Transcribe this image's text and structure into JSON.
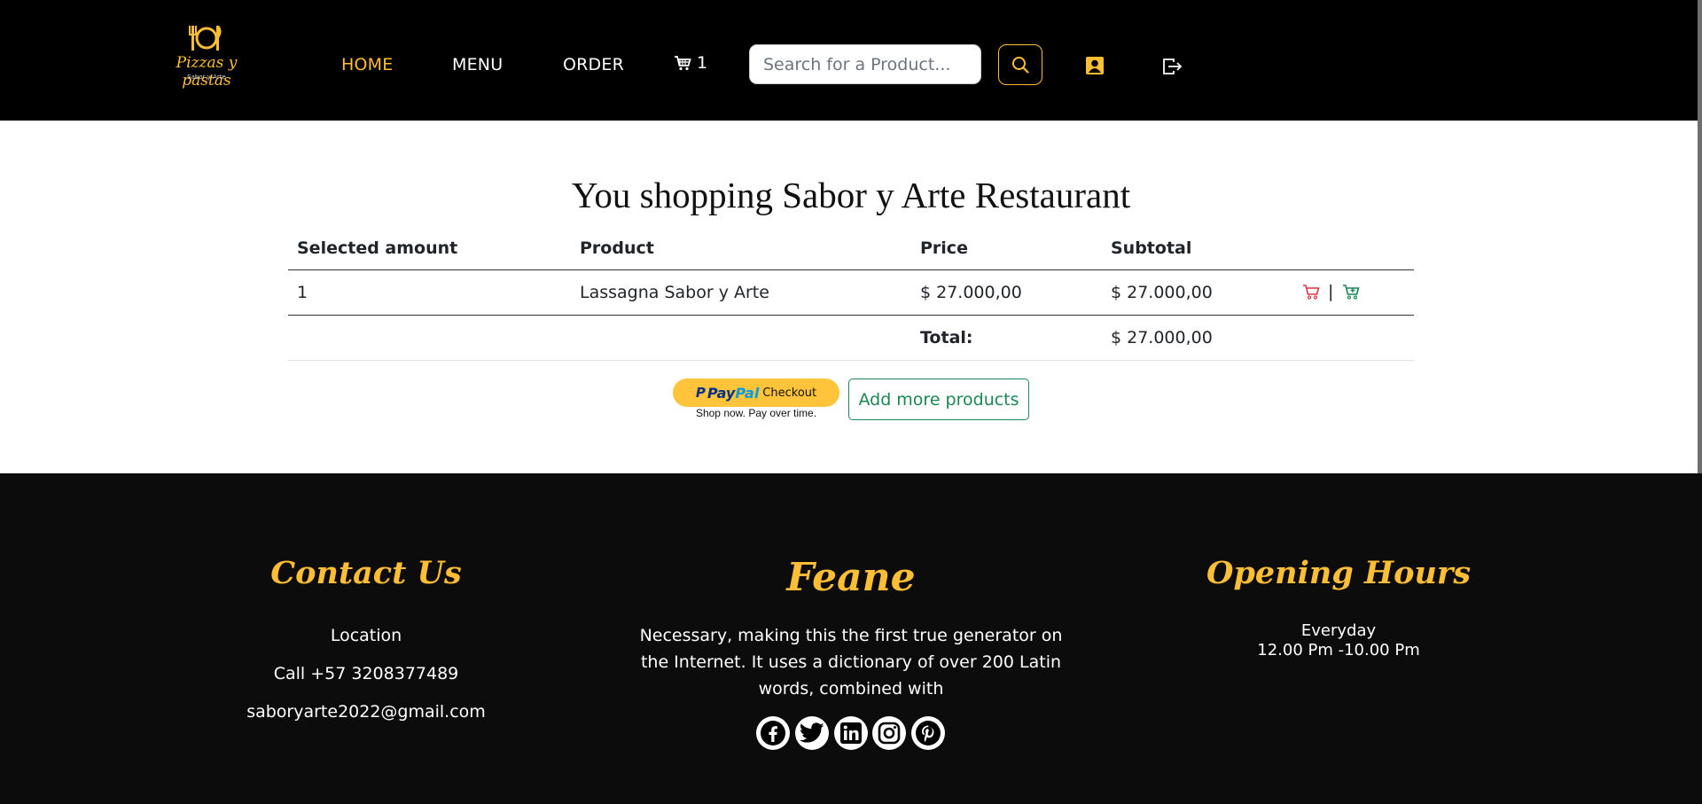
{
  "header": {
    "logo_text": "Pizzas y pastas",
    "logo_subtext": "Sabor y Arte",
    "nav": [
      {
        "label": "HOME",
        "active": true
      },
      {
        "label": "MENU",
        "active": false
      },
      {
        "label": "ORDER",
        "active": false
      }
    ],
    "cart_count": "1",
    "search_placeholder": "Search for a Product...",
    "icons": [
      "utensils-logo-icon",
      "cart-icon",
      "search-icon",
      "user-icon",
      "logout-icon"
    ]
  },
  "main": {
    "title": "You shopping Sabor y Arte Restaurant",
    "table": {
      "headers": [
        "Selected amount",
        "Product",
        "Price",
        "Subtotal"
      ],
      "rows": [
        {
          "amount": "1",
          "product": "Lassagna Sabor y Arte",
          "price": "$ 27.000,00",
          "subtotal": "$ 27.000,00"
        }
      ],
      "total_label": "Total:",
      "total_value": "$ 27.000,00",
      "action_separator": "|"
    },
    "paypal": {
      "brand_pay": "Pay",
      "brand_pal": "Pal",
      "label": "Checkout",
      "tagline": "Shop now. Pay over time."
    },
    "add_more_label": "Add more products"
  },
  "footer": {
    "contact": {
      "heading": "Contact Us",
      "location": "Location",
      "phone": "Call +57 3208377489",
      "email": "saboryarte2022@gmail.com"
    },
    "brand": {
      "heading": "Feane",
      "text": "Necessary, making this the first true generator on the Internet. It uses a dictionary of over 200 Latin words, combined with",
      "social": [
        "facebook-icon",
        "twitter-icon",
        "linkedin-icon",
        "instagram-icon",
        "pinterest-icon"
      ]
    },
    "hours": {
      "heading": "Opening Hours",
      "days": "Everyday",
      "time": "12.00 Pm -10.00 Pm"
    }
  },
  "colors": {
    "accent": "#ffbe33",
    "header_bg": "#000000",
    "footer_bg": "#0c0c0c",
    "success": "#198754",
    "danger": "#dc3545",
    "paypal": "#ffc439"
  }
}
